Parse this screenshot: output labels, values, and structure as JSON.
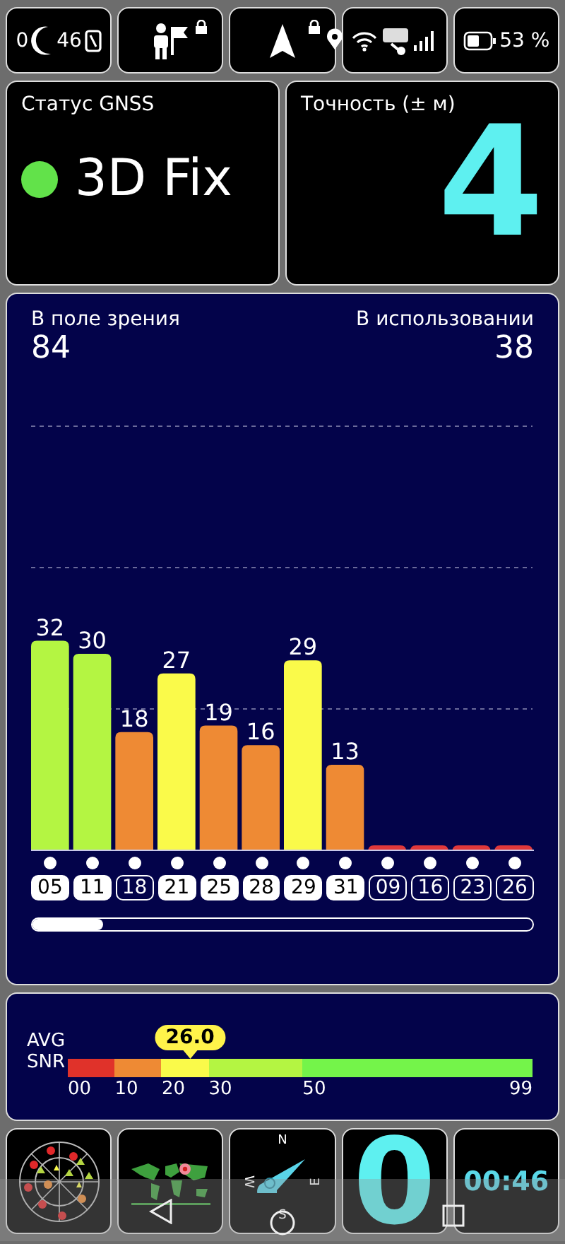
{
  "status_bar": {
    "clock_start": "0",
    "clock_end": "46",
    "battery": "53 %"
  },
  "gnss_status": {
    "label": "Статус GNSS",
    "value": "3D Fix",
    "color": "#62e24a"
  },
  "accuracy": {
    "label": "Точность (± м)",
    "value": "4"
  },
  "satellites": {
    "in_view_label": "В поле зрения",
    "in_view": "84",
    "in_use_label": "В использовании",
    "in_use": "38",
    "chart_data": {
      "type": "bar",
      "categories": [
        "05",
        "11",
        "18",
        "21",
        "25",
        "28",
        "29",
        "31",
        "09",
        "16",
        "23",
        "26"
      ],
      "values": [
        32,
        30,
        18,
        27,
        19,
        16,
        29,
        13,
        0,
        0,
        0,
        0
      ],
      "value_labels": [
        "32",
        "30",
        "18",
        "27",
        "19",
        "16",
        "29",
        "13",
        null,
        null,
        null,
        null
      ]
    },
    "items": [
      {
        "used": true
      },
      {
        "used": true
      },
      {
        "used": false
      },
      {
        "used": true
      },
      {
        "used": true
      },
      {
        "used": true
      },
      {
        "used": true
      },
      {
        "used": true
      },
      {
        "used": false
      },
      {
        "used": false
      },
      {
        "used": false
      },
      {
        "used": false
      }
    ]
  },
  "snr": {
    "label_top": "AVG",
    "label_bottom": "SNR",
    "average": "26.0",
    "segments": [
      {
        "color": "#e0322a"
      },
      {
        "color": "#ee8a34"
      },
      {
        "color": "#fafa4a"
      },
      {
        "color": "#b4f542"
      },
      {
        "color": "#74f44a"
      }
    ],
    "ticks": [
      "00",
      "10",
      "20",
      "30",
      "50",
      "99"
    ]
  },
  "bottom_tiles": {
    "compass": {
      "north": "N",
      "west": "W",
      "east": "E",
      "south": "S"
    },
    "speed": "0",
    "clock": "00:46"
  }
}
